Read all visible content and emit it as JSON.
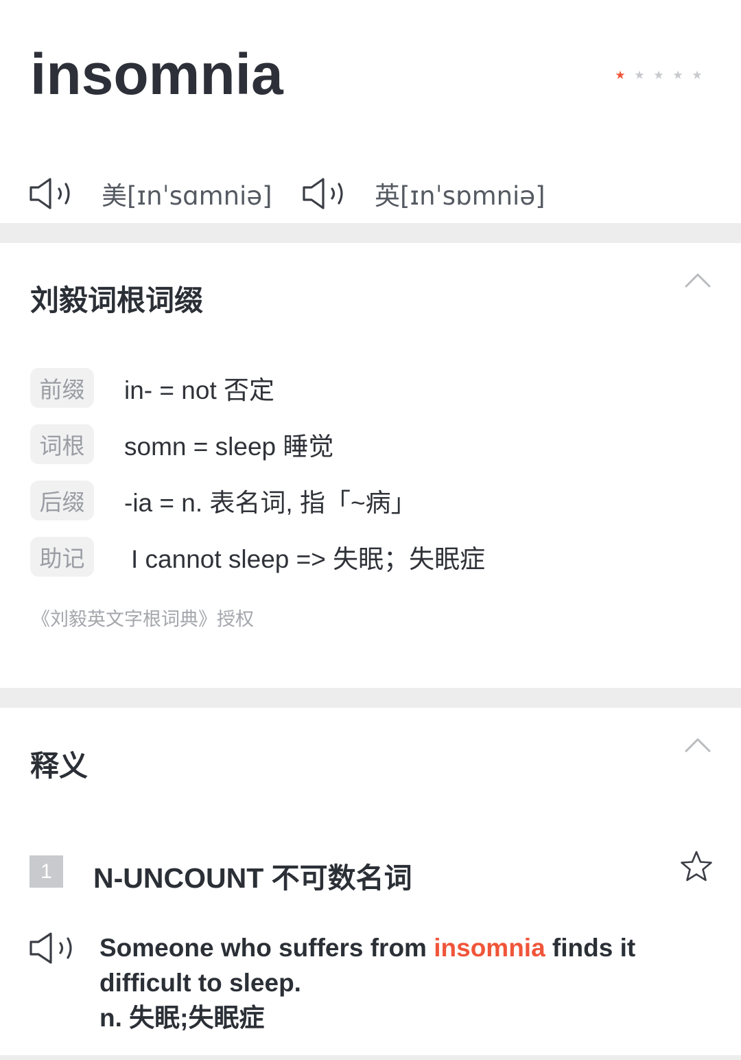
{
  "word": "insomnia",
  "frequency": {
    "stars_filled": 1,
    "stars_total": 5,
    "color_filled": "#f0553a",
    "color_empty": "#c7c9cd"
  },
  "pronunciations": [
    {
      "region": "美",
      "ipa": "[ɪnˈsɑmniə]",
      "icon": "speaker-icon"
    },
    {
      "region": "英",
      "ipa": "[ɪnˈsɒmniə]",
      "icon": "speaker-icon"
    }
  ],
  "roots": {
    "title": "刘毅词根词缀",
    "items": [
      {
        "tag": "前缀",
        "text": "in- = not 否定"
      },
      {
        "tag": "词根",
        "text": "somn = sleep 睡觉"
      },
      {
        "tag": "后缀",
        "text": "-ia = n. 表名词, 指「~病」"
      },
      {
        "tag": "助记",
        "text": "I cannot sleep => 失眠；失眠症"
      }
    ],
    "credit": "《刘毅英文字根词典》授权"
  },
  "definitions": {
    "title": "释义",
    "entries": [
      {
        "number": "1",
        "pos": "N-UNCOUNT 不可数名词",
        "example_before": "Someone who suffers from ",
        "example_highlight": "insomnia",
        "example_after": " finds it difficult to sleep.",
        "translation": "n. 失眠;失眠症"
      }
    ]
  },
  "colors": {
    "accent": "#f0553a",
    "divider": "#ededee",
    "text": "#2b2f36"
  }
}
